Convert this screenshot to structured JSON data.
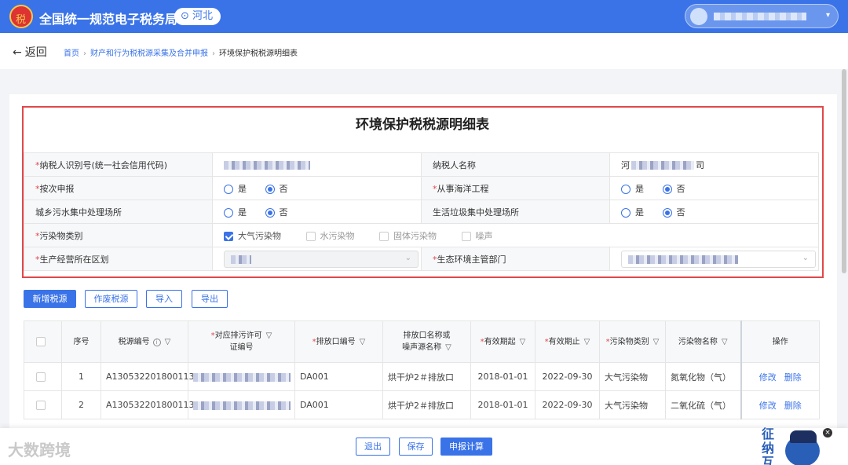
{
  "header": {
    "app_title": "全国统一规范电子税务局",
    "region": "河北",
    "region_icon": "location-pin-icon",
    "emblem_text": "税",
    "user_caret": "▾"
  },
  "nav": {
    "back_label": "返回",
    "back_arrow": "←",
    "breadcrumbs": [
      "首页",
      "财产和行为税税源采集及合并申报",
      "环境保护税税源明细表"
    ],
    "sep": "›"
  },
  "form": {
    "title": "环境保护税税源明细表",
    "taxpayer_id_label": "纳税人识别号(统一社会信用代码)",
    "taxpayer_name_label": "纳税人名称",
    "taxpayer_name_prefix": "河",
    "taxpayer_name_suffix": "司",
    "by_frequency_label": "按次申报",
    "marine_label": "从事海洋工程",
    "urban_sewage_label": "城乡污水集中处理场所",
    "garbage_label": "生活垃圾集中处理场所",
    "pollutant_type_label": "污染物类别",
    "pollutant_options": [
      "大气污染物",
      "水污染物",
      "固体污染物",
      "噪声"
    ],
    "region_label": "生产经营所在区划",
    "eco_dept_label": "生态环境主管部门",
    "yes": "是",
    "no": "否",
    "required_mark": "*",
    "chevron": "⌄"
  },
  "actions": {
    "add": "新增税源",
    "void": "作废税源",
    "import": "导入",
    "export": "导出"
  },
  "table": {
    "headers": {
      "seq": "序号",
      "source_no": "税源编号",
      "permit_line1": "对应排污许可",
      "permit_line2": "证编号",
      "outlet_no": "排放口编号",
      "outlet_name_line1": "排放口名称或",
      "outlet_name_line2": "噪声源名称",
      "valid_from": "有效期起",
      "valid_to": "有效期止",
      "pollutant_type": "污染物类别",
      "pollutant_name": "污染物名称",
      "ops": "操作"
    },
    "filter_icon": "▽",
    "info_icon": "i",
    "rows": [
      {
        "seq": "1",
        "source_no": "A130532201800113",
        "outlet_no": "DA001",
        "outlet_name": "烘干炉2＃排放口",
        "valid_from": "2018-01-01",
        "valid_to": "2022-09-30",
        "pollutant_type": "大气污染物",
        "pollutant_name": "氮氧化物（气）",
        "edit": "修改",
        "delete": "删除"
      },
      {
        "seq": "2",
        "source_no": "A130532201800113",
        "outlet_no": "DA001",
        "outlet_name": "烘干炉2＃排放口",
        "valid_from": "2018-01-01",
        "valid_to": "2022-09-30",
        "pollutant_type": "大气污染物",
        "pollutant_name": "二氧化硫（气）",
        "edit": "修改",
        "delete": "删除"
      }
    ]
  },
  "footer": {
    "exit": "退出",
    "save": "保存",
    "calc": "申报计算",
    "watermark": "大数跨境",
    "helper_text": "征纳互",
    "close": "×"
  }
}
